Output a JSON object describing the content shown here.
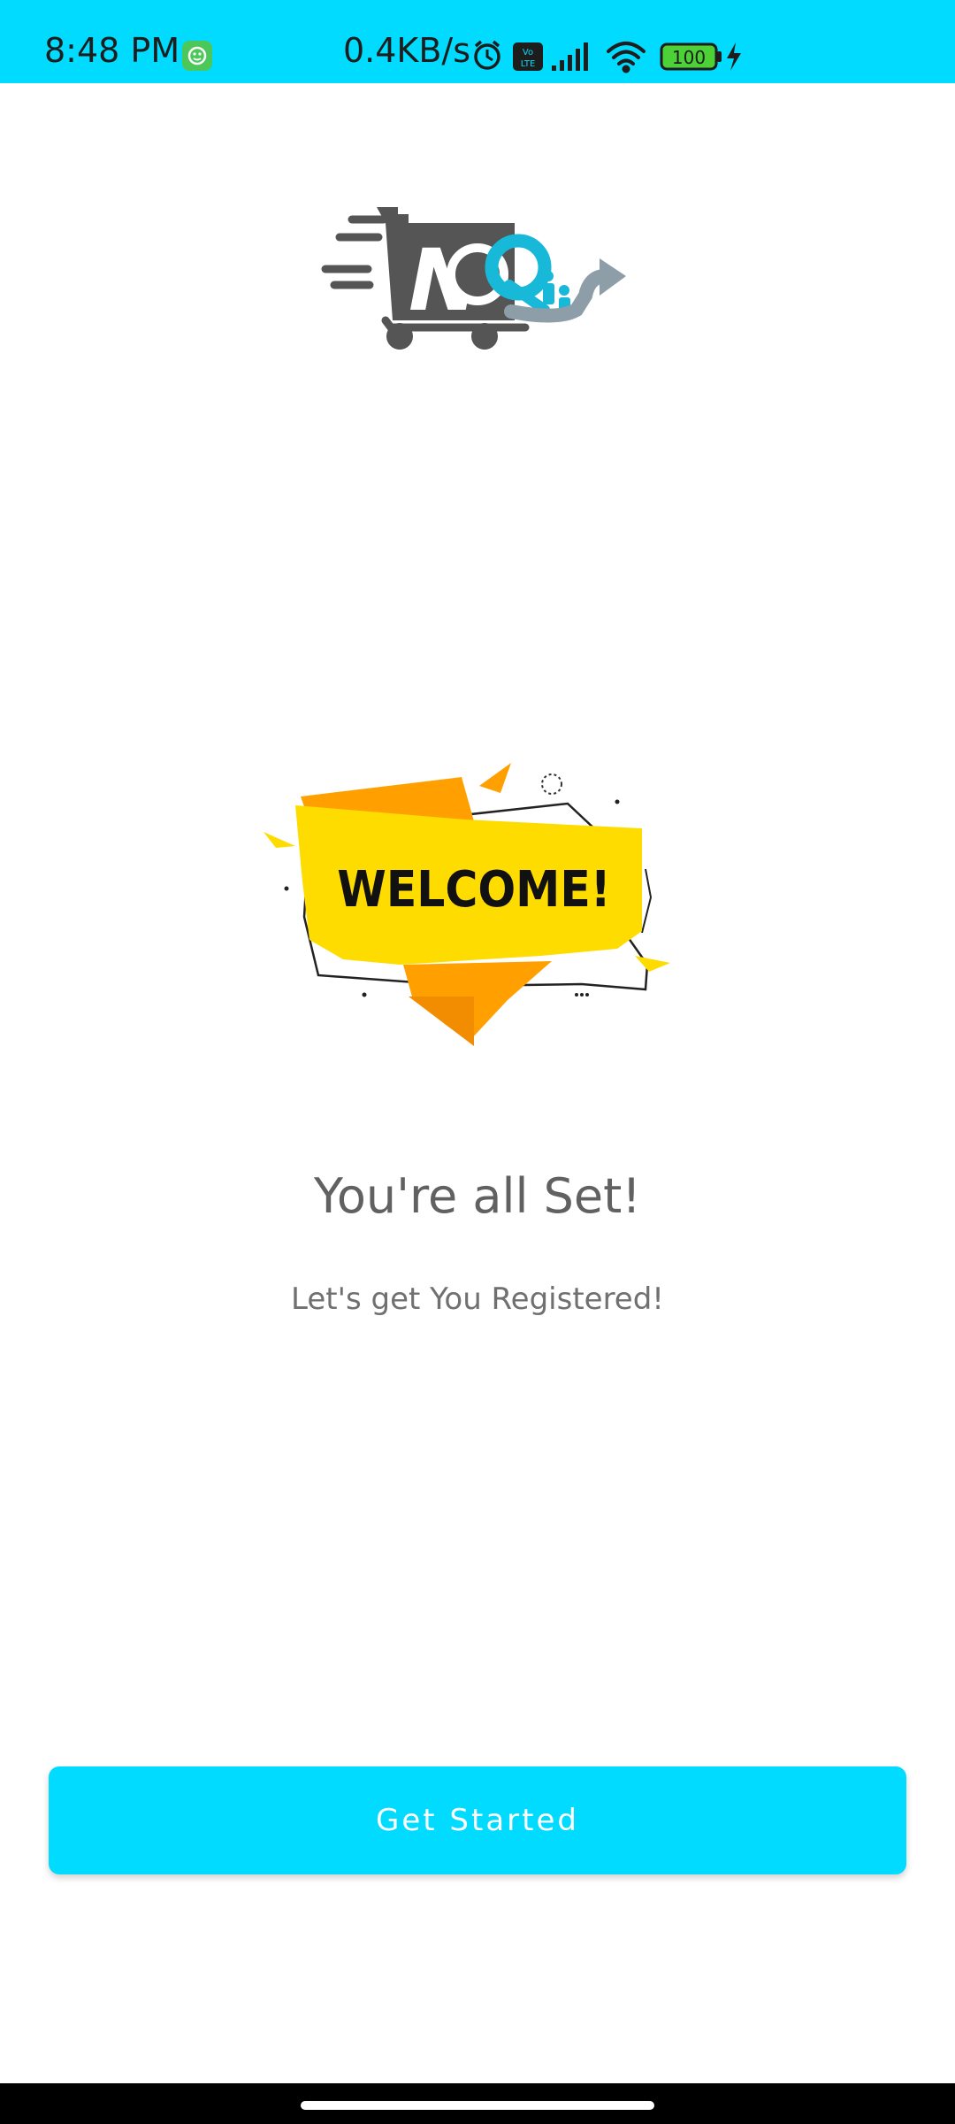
{
  "status_bar": {
    "time": "8:48 PM",
    "network_speed": "0.4KB/s",
    "volte_label": "Vo LTE",
    "battery": "100",
    "icons": [
      "app-notification-icon",
      "alarm-icon",
      "volte-icon",
      "signal-icon",
      "wifi-icon",
      "battery-icon",
      "charging-icon"
    ]
  },
  "logo": {
    "text": "NoQ"
  },
  "banner": {
    "text": "WELCOME!"
  },
  "main": {
    "title": "You're all Set!",
    "subtitle": "Let's get You Registered!",
    "cta_label": "Get Started"
  },
  "colors": {
    "accent": "#00dbff",
    "banner_yellow": "#ffdc00",
    "banner_orange": "#ffa000",
    "logo_gray": "#555555",
    "logo_blue": "#18b8d8"
  }
}
